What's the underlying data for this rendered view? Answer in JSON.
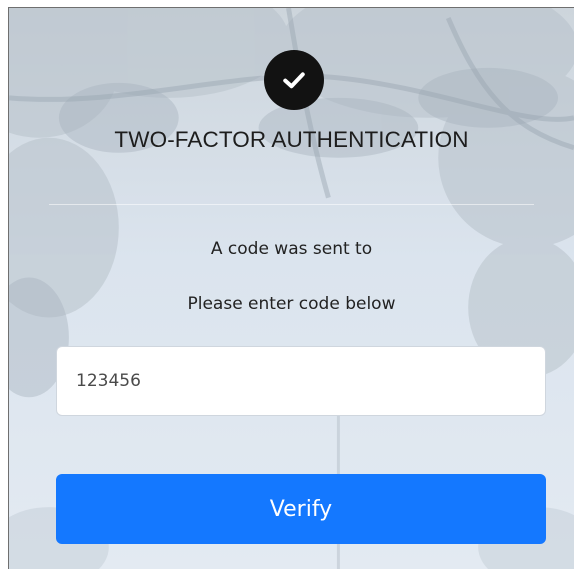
{
  "header": {
    "icon": "check-circle-icon",
    "title": "TWO-FACTOR AUTHENTICATION"
  },
  "message": {
    "line1": "A code was sent to",
    "line2": "Please enter code below"
  },
  "code_input": {
    "value": "123456",
    "placeholder": ""
  },
  "verify_button": {
    "label": "Verify"
  },
  "colors": {
    "accent": "#1478ff",
    "icon_bg": "#121212",
    "card_bg": "#dfe7ef"
  }
}
